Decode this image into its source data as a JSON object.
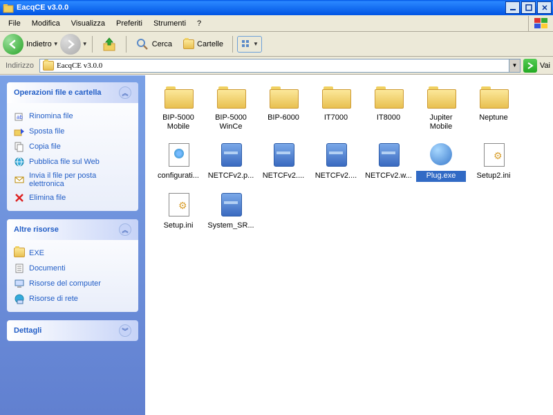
{
  "window": {
    "title": "EacqCE v3.0.0"
  },
  "menu": [
    "File",
    "Modifica",
    "Visualizza",
    "Preferiti",
    "Strumenti",
    "?"
  ],
  "toolbar": {
    "back": "Indietro",
    "search": "Cerca",
    "folders": "Cartelle"
  },
  "address": {
    "label": "Indirizzo",
    "value": "EacqCE v3.0.0",
    "go": "Vai"
  },
  "sidebar": {
    "panels": [
      {
        "title": "Operazioni file e cartella",
        "expanded": true,
        "items": [
          {
            "icon": "rename",
            "label": "Rinomina file"
          },
          {
            "icon": "move",
            "label": "Sposta file"
          },
          {
            "icon": "copy",
            "label": "Copia file"
          },
          {
            "icon": "publish",
            "label": "Pubblica file sul Web"
          },
          {
            "icon": "email",
            "label": "Invia il file per posta elettronica"
          },
          {
            "icon": "delete",
            "label": "Elimina file"
          }
        ]
      },
      {
        "title": "Altre risorse",
        "expanded": true,
        "items": [
          {
            "icon": "folder",
            "label": "EXE"
          },
          {
            "icon": "docs",
            "label": "Documenti"
          },
          {
            "icon": "computer",
            "label": "Risorse del computer"
          },
          {
            "icon": "network",
            "label": "Risorse di rete"
          }
        ]
      },
      {
        "title": "Dettagli",
        "expanded": false,
        "items": []
      }
    ]
  },
  "files": [
    {
      "name": "BIP-5000 Mobile",
      "type": "folder"
    },
    {
      "name": "BIP-5000 WinCe",
      "type": "folder"
    },
    {
      "name": "BIP-6000",
      "type": "folder"
    },
    {
      "name": "IT7000",
      "type": "folder"
    },
    {
      "name": "IT8000",
      "type": "folder"
    },
    {
      "name": "Jupiter Mobile",
      "type": "folder"
    },
    {
      "name": "Neptune",
      "type": "folder"
    },
    {
      "name": "configurati...",
      "type": "html"
    },
    {
      "name": "NETCFv2.p...",
      "type": "cab"
    },
    {
      "name": "NETCFv2....",
      "type": "cab"
    },
    {
      "name": "NETCFv2....",
      "type": "cab"
    },
    {
      "name": "NETCFv2.w...",
      "type": "cab"
    },
    {
      "name": "Plug.exe",
      "type": "exe",
      "selected": true
    },
    {
      "name": "Setup2.ini",
      "type": "ini"
    },
    {
      "name": "Setup.ini",
      "type": "ini"
    },
    {
      "name": "System_SR...",
      "type": "cab"
    }
  ]
}
